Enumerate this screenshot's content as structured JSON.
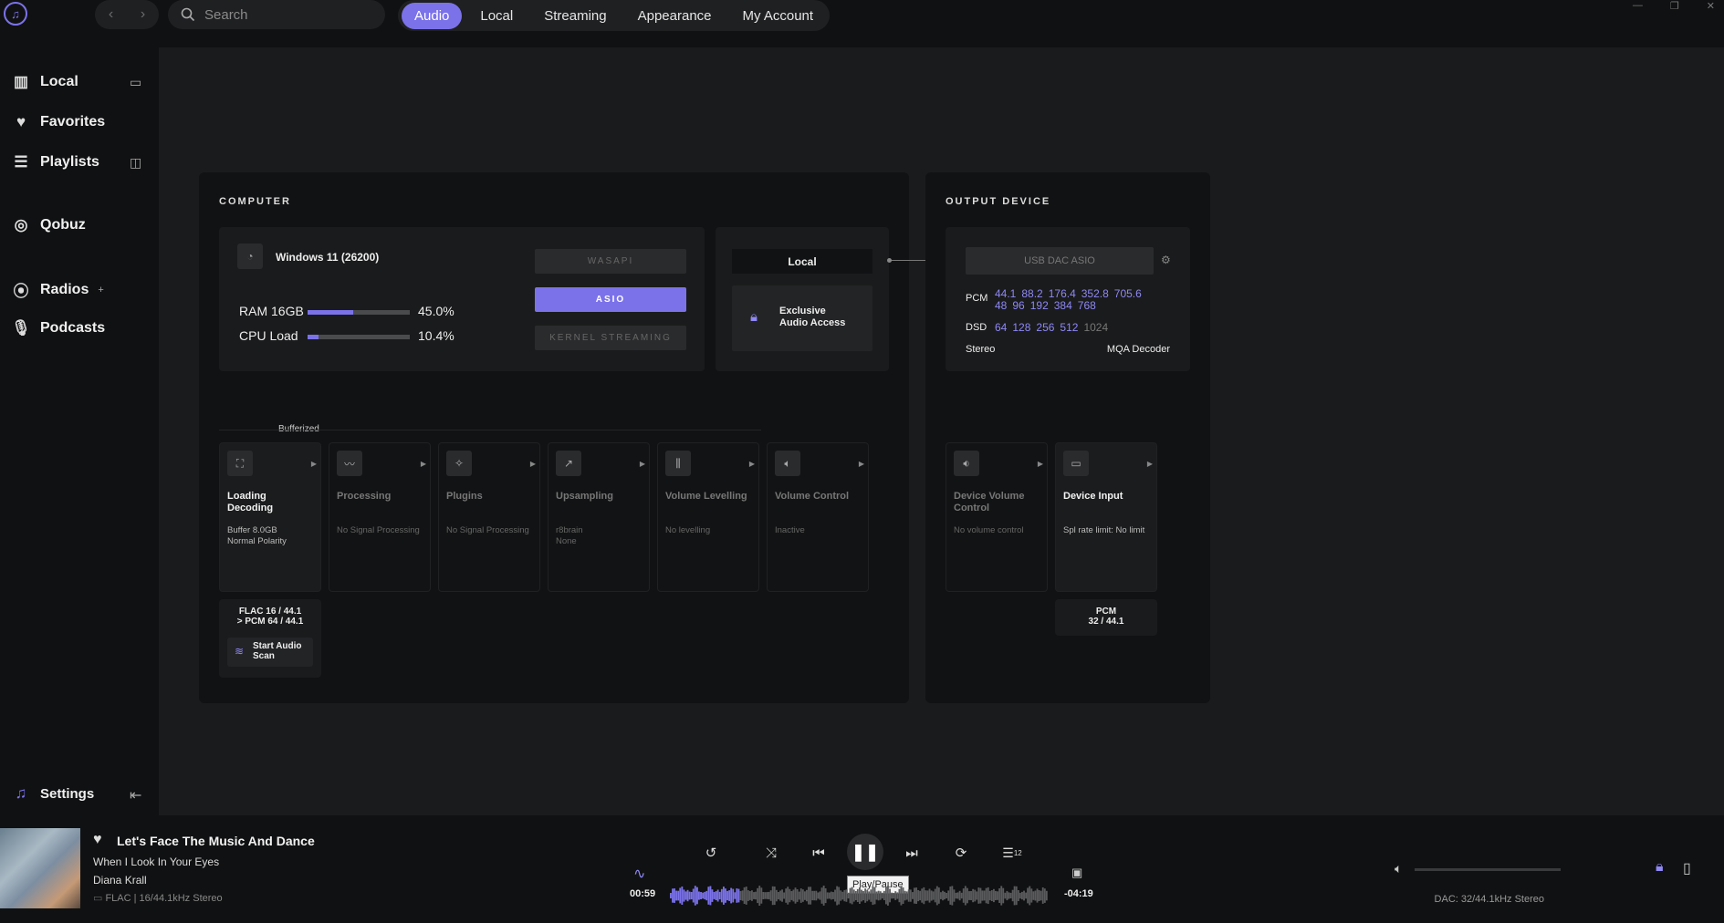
{
  "topbar": {
    "search_placeholder": "Search",
    "tabs": [
      "Audio",
      "Local",
      "Streaming",
      "Appearance",
      "My Account"
    ],
    "active_tab": "Audio"
  },
  "sidebar": {
    "items": [
      {
        "label": "Local",
        "icon": "library-icon"
      },
      {
        "label": "Favorites",
        "icon": "heart-icon"
      },
      {
        "label": "Playlists",
        "icon": "playlist-icon"
      },
      {
        "label": "Qobuz",
        "icon": "qobuz-icon"
      },
      {
        "label": "Radios",
        "icon": "radio-icon"
      },
      {
        "label": "Podcasts",
        "icon": "microphone-icon"
      }
    ],
    "radios_add": "+",
    "settings_label": "Settings"
  },
  "computer": {
    "title": "COMPUTER",
    "os": "Windows 11 (26200)",
    "ram_label": "RAM 16GB",
    "ram_value": "45.0%",
    "ram_fraction": 0.45,
    "cpu_label": "CPU Load",
    "cpu_value": "10.4%",
    "cpu_fraction": 0.104,
    "modes": {
      "wasapi": "WASAPI",
      "asio": "ASIO",
      "kernel": "KERNEL STREAMING"
    },
    "active_mode": "ASIO",
    "route": "Local",
    "exclusive": "Exclusive\nAudio Access",
    "bufferized": "Bufferized"
  },
  "output": {
    "title": "OUTPUT DEVICE",
    "device": "USB DAC ASIO",
    "pcm_label": "PCM",
    "pcm_row1": [
      "44.1",
      "88.2",
      "176.4",
      "352.8",
      "705.6"
    ],
    "pcm_row2": [
      "48",
      "96",
      "192",
      "384",
      "768"
    ],
    "dsd_label": "DSD",
    "dsd_rates": [
      "64",
      "128",
      "256",
      "512"
    ],
    "dsd_unsupported": "1024",
    "channels": "Stereo",
    "mqa": "MQA Decoder"
  },
  "pipeline": {
    "stages": [
      {
        "title": "Loading\nDecoding",
        "desc": "Buffer 8.0GB\nNormal Polarity",
        "icon": "expand-icon",
        "active": true
      },
      {
        "title": "Processing",
        "desc": "No Signal Processing",
        "icon": "waveform-icon",
        "active": false
      },
      {
        "title": "Plugins",
        "desc": "No Signal Processing",
        "icon": "sparkle-icon",
        "active": false
      },
      {
        "title": "Upsampling",
        "desc": "r8brain\nNone",
        "icon": "upsample-icon",
        "active": false
      },
      {
        "title": "Volume Levelling",
        "desc": "No levelling",
        "icon": "levels-icon",
        "active": false
      },
      {
        "title": "Volume Control",
        "desc": "Inactive",
        "icon": "speaker-icon",
        "active": false
      }
    ],
    "device_stages": [
      {
        "title": "Device Volume Control",
        "desc": "No volume control",
        "icon": "device-volume-icon",
        "active": false
      },
      {
        "title": "Device Input",
        "desc": "Spl rate limit: No limit",
        "icon": "input-icon",
        "active": true
      }
    ],
    "format_in": "FLAC 16 / 44.1\n> PCM 64 / 44.1",
    "scan_label": "Start Audio\nScan",
    "device_format": "PCM\n32 / 44.1"
  },
  "player": {
    "title": "Let's Face The Music And Dance",
    "album": "When I Look In Your Eyes",
    "artist": "Diana Krall",
    "format": "FLAC | 16/44.1kHz Stereo",
    "elapsed": "00:59",
    "remaining": "-04:19",
    "progress": 0.185,
    "tooltip": "Play/Pause",
    "dac": "DAC: 32/44.1kHz Stereo",
    "queue_count": "12"
  }
}
